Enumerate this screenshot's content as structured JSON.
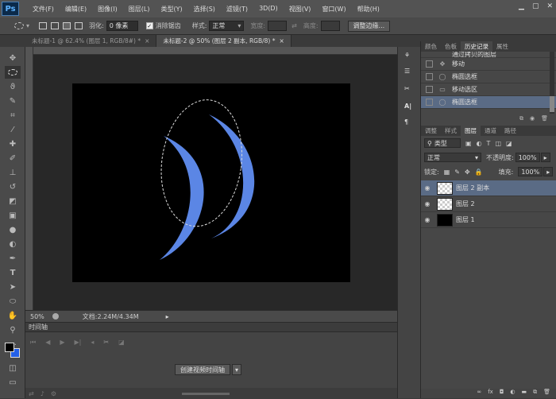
{
  "app": {
    "logo": "Ps"
  },
  "menu": [
    "文件(F)",
    "编辑(E)",
    "图像(I)",
    "图层(L)",
    "类型(Y)",
    "选择(S)",
    "滤镜(T)",
    "3D(D)",
    "视图(V)",
    "窗口(W)",
    "帮助(H)"
  ],
  "options": {
    "feather_label": "羽化:",
    "feather_value": "0 像素",
    "antialias_label": "消除锯齿",
    "style_label": "样式:",
    "style_value": "正常",
    "width_label": "宽度:",
    "height_label": "高度:",
    "refine_button": "调整边缘..."
  },
  "tabs": [
    {
      "label": "未标题-1 @ 62.4% (图层 1, RGB/8#) *"
    },
    {
      "label": "未标题-2 @ 50% (图层 2 副本, RGB/8) *"
    }
  ],
  "status": {
    "zoom": "50%",
    "doc": "文档:2.24M/4.34M"
  },
  "timeline": {
    "title": "时间轴",
    "create_button": "创建视频时间轴"
  },
  "history": {
    "tabs": [
      "颜色",
      "色板",
      "历史记录",
      "属性"
    ],
    "rows": [
      "通过拷贝的图层",
      "移动",
      "椭圆选框",
      "移动选区",
      "椭圆选框"
    ]
  },
  "layers": {
    "tabs": [
      "调整",
      "样式",
      "图层",
      "通道",
      "路径"
    ],
    "filter_label": "类型",
    "blend_mode": "正常",
    "opacity_label": "不透明度:",
    "opacity_value": "100%",
    "lock_label": "锁定:",
    "fill_label": "填充:",
    "fill_value": "100%",
    "rows": [
      "图层 2 副本",
      "图层 2",
      "图层 1"
    ]
  },
  "colors": {
    "accent": "#5b86e5",
    "selection": "#5a6b85"
  }
}
